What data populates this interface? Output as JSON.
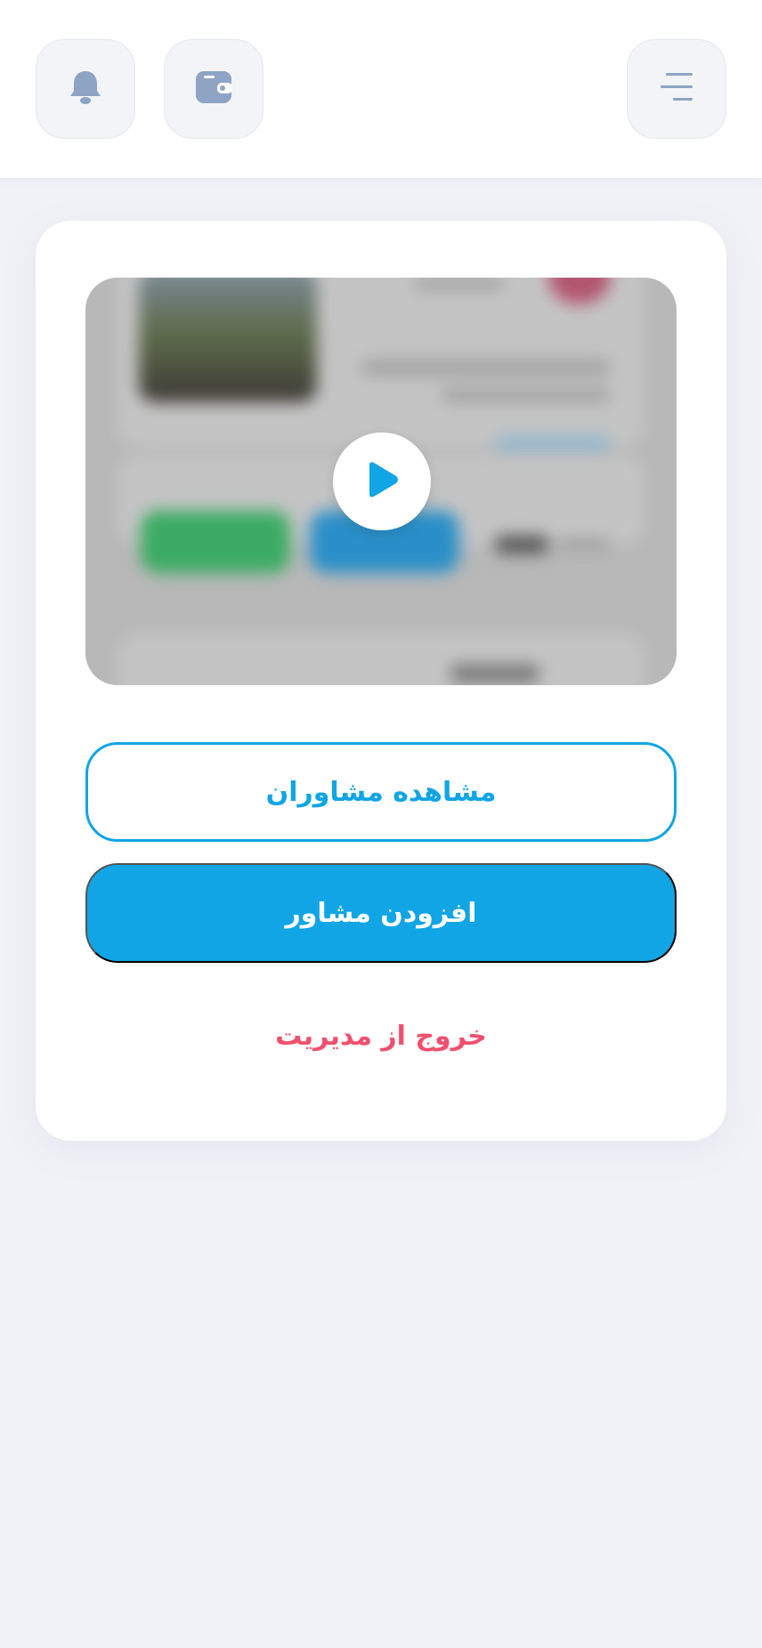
{
  "header": {
    "icons": {
      "bell": "bell-icon",
      "wallet": "wallet-icon",
      "menu": "menu-icon"
    },
    "icon_color": "#8fa3c4"
  },
  "main": {
    "video": {
      "play_icon": "play-icon"
    },
    "view_advisors_label": "مشاهده مشاوران",
    "add_advisor_label": "افزودن مشاور",
    "logout_label": "خروج از مدیریت"
  },
  "colors": {
    "accent": "#11a5e5",
    "danger": "#f0506e",
    "background": "#f1f2f7",
    "surface": "#ffffff"
  }
}
